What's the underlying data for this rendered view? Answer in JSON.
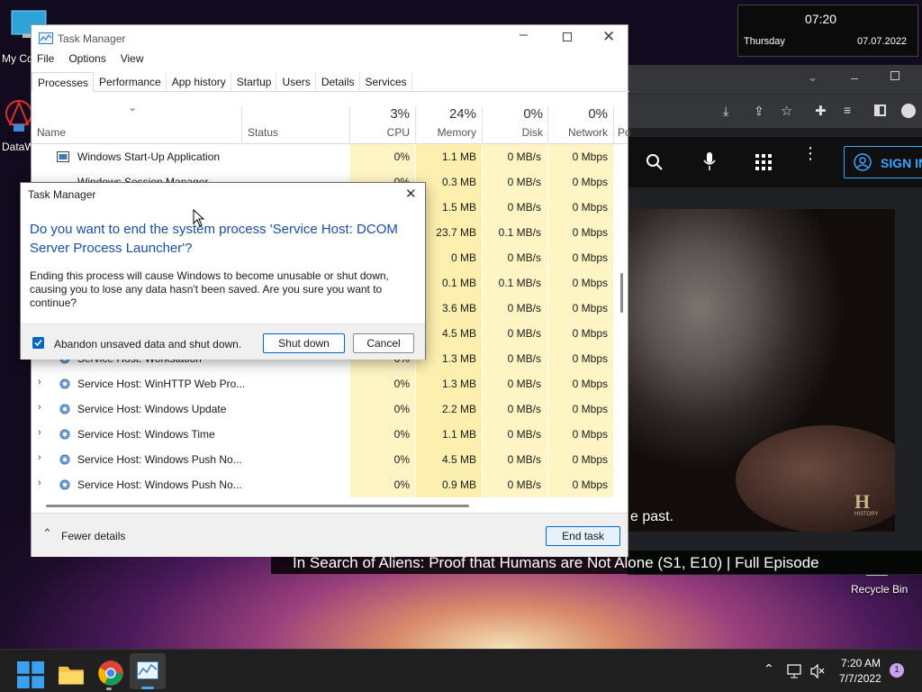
{
  "desktop": {
    "icons": [
      {
        "label": "My Co"
      },
      {
        "label": "DataW"
      },
      {
        "label": "Recycle Bin"
      }
    ]
  },
  "clock_widget": {
    "time": "07:20",
    "day": "Thursday",
    "date": "07.07.2022"
  },
  "browser": {
    "sign_in_label": "SIGN IN",
    "subtitle": "e past.",
    "video_title": "In Search of Aliens: Proof that Humans are Not Alone (S1, E10) | Full Episode",
    "watermark": "HISTORY"
  },
  "task_manager": {
    "title": "Task Manager",
    "menu": [
      "File",
      "Options",
      "View"
    ],
    "tabs": [
      "Processes",
      "Performance",
      "App history",
      "Startup",
      "Users",
      "Details",
      "Services"
    ],
    "columns": {
      "name": "Name",
      "status": "Status",
      "cpu_pct": "3%",
      "cpu": "CPU",
      "memory_pct": "24%",
      "memory": "Memory",
      "disk_pct": "0%",
      "disk": "Disk",
      "network_pct": "0%",
      "network": "Network",
      "power": "Po"
    },
    "rows": [
      {
        "name": "Windows Start-Up Application",
        "cpu": "0%",
        "mem": "1.1 MB",
        "disk": "0 MB/s",
        "net": "0 Mbps"
      },
      {
        "name": "Windows Session Manager",
        "cpu": "0%",
        "mem": "0.3 MB",
        "disk": "0 MB/s",
        "net": "0 Mbps"
      },
      {
        "name": "",
        "cpu": "",
        "mem": "1.5 MB",
        "disk": "0 MB/s",
        "net": "0 Mbps"
      },
      {
        "name": "",
        "cpu": "",
        "mem": "23.7 MB",
        "disk": "0.1 MB/s",
        "net": "0 Mbps"
      },
      {
        "name": "",
        "cpu": "",
        "mem": "0 MB",
        "disk": "0 MB/s",
        "net": "0 Mbps"
      },
      {
        "name": "",
        "cpu": "",
        "mem": "0.1 MB",
        "disk": "0.1 MB/s",
        "net": "0 Mbps"
      },
      {
        "name": "",
        "cpu": "",
        "mem": "3.6 MB",
        "disk": "0 MB/s",
        "net": "0 Mbps"
      },
      {
        "name": "",
        "cpu": "",
        "mem": "4.5 MB",
        "disk": "0 MB/s",
        "net": "0 Mbps"
      },
      {
        "name": "Service Host: Workstation",
        "cpu": "0%",
        "mem": "1.3 MB",
        "disk": "0 MB/s",
        "net": "0 Mbps"
      },
      {
        "name": "Service Host: WinHTTP Web Pro...",
        "cpu": "0%",
        "mem": "1.3 MB",
        "disk": "0 MB/s",
        "net": "0 Mbps"
      },
      {
        "name": "Service Host: Windows Update",
        "cpu": "0%",
        "mem": "2.2 MB",
        "disk": "0 MB/s",
        "net": "0 Mbps"
      },
      {
        "name": "Service Host: Windows Time",
        "cpu": "0%",
        "mem": "1.1 MB",
        "disk": "0 MB/s",
        "net": "0 Mbps"
      },
      {
        "name": "Service Host: Windows Push No...",
        "cpu": "0%",
        "mem": "4.5 MB",
        "disk": "0 MB/s",
        "net": "0 Mbps"
      },
      {
        "name": "Service Host: Windows Push No...",
        "cpu": "0%",
        "mem": "0.9 MB",
        "disk": "0 MB/s",
        "net": "0 Mbps"
      }
    ],
    "fewer_details": "Fewer details",
    "end_task": "End task"
  },
  "dialog": {
    "title": "Task Manager",
    "heading": "Do you want to end the system process 'Service Host: DCOM Server Process Launcher'?",
    "body": "Ending this process will cause Windows to become unusable or shut down, causing you to lose any data hasn't been saved. Are you sure you want to continue?",
    "checkbox_label": "Abandon unsaved data and shut down.",
    "checkbox_checked": true,
    "shutdown_label": "Shut down",
    "cancel_label": "Cancel"
  },
  "taskbar": {
    "time": "7:20 AM",
    "date": "7/7/2022",
    "notification_count": "1"
  },
  "colors": {
    "accent": "#0067c0",
    "highlight_col": "#fff4c4",
    "dialog_heading": "#1a4f9c"
  }
}
